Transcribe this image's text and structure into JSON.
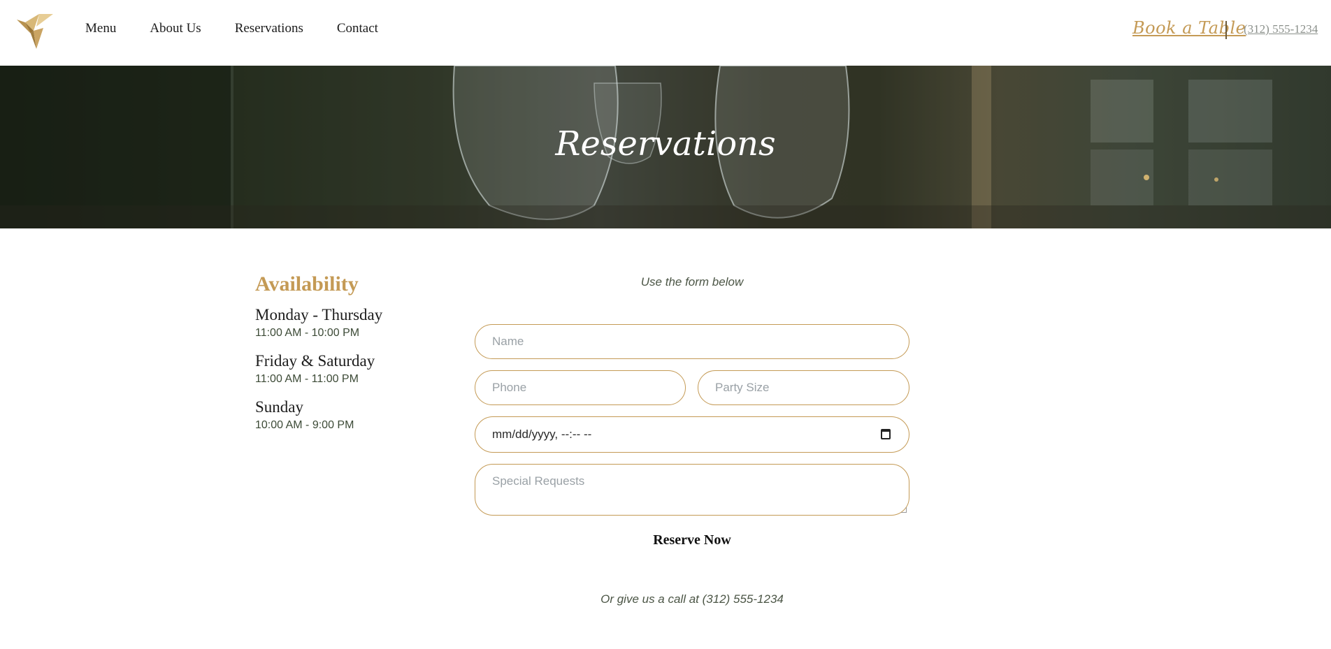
{
  "header": {
    "logo_icon": "origami-bird-logo",
    "nav": [
      {
        "label": "Menu"
      },
      {
        "label": "About Us"
      },
      {
        "label": "Reservations"
      },
      {
        "label": "Contact"
      }
    ],
    "book_label": "Book a Table",
    "phone": "(312) 555-1234"
  },
  "hero": {
    "title": "Reservations"
  },
  "availability": {
    "heading": "Availability",
    "schedule": [
      {
        "day": "Monday - Thursday",
        "hours": "11:00 AM - 10:00 PM"
      },
      {
        "day": "Friday & Saturday",
        "hours": "11:00 AM - 11:00 PM"
      },
      {
        "day": "Sunday",
        "hours": "10:00 AM - 9:00 PM"
      }
    ]
  },
  "form": {
    "intro": "Use the form below",
    "name_placeholder": "Name",
    "phone_placeholder": "Phone",
    "party_placeholder": "Party Size",
    "datetime_value": "mm/dd/yyyy, --:-- --",
    "requests_placeholder": "Special Requests",
    "submit_label": "Reserve Now",
    "call_text": "Or give us a call at (312) 555-1234"
  },
  "colors": {
    "accent": "#c49a55",
    "text_dark": "#1c1c1c",
    "text_muted": "#4b5545"
  }
}
